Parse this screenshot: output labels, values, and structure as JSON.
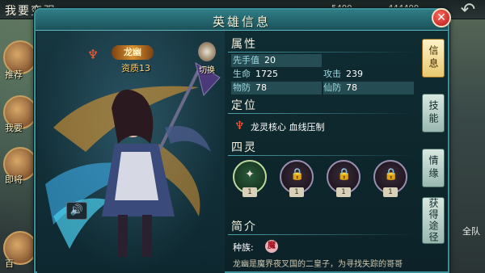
{
  "background": {
    "title": "我要变强",
    "resource_1": "5400",
    "resource_2": "444400",
    "left_labels": [
      "推荐",
      "我要",
      "即将",
      "百"
    ],
    "right_label": "全队"
  },
  "dialog": {
    "title": "英雄信息",
    "close_label": "✕"
  },
  "hero": {
    "name": "龙幽",
    "aptitude": "资质13",
    "switch_label": "切换",
    "faction_icon": "flame-icon",
    "voice_icon": "speaker-icon"
  },
  "attributes": {
    "section_title": "属性",
    "first_strike_label": "先手值",
    "first_strike_value": "20",
    "rows": [
      {
        "label": "生命",
        "value": "1725"
      },
      {
        "label": "攻击",
        "value": "239"
      },
      {
        "label": "物防",
        "value": "78"
      },
      {
        "label": "仙防",
        "value": "78"
      }
    ]
  },
  "position": {
    "section_title": "定位",
    "text": "龙灵核心 血线压制"
  },
  "spirits": {
    "section_title": "四灵",
    "slots": [
      {
        "level": "1",
        "state": "active"
      },
      {
        "level": "1",
        "state": "locked"
      },
      {
        "level": "1",
        "state": "locked"
      },
      {
        "level": "1",
        "state": "locked"
      }
    ]
  },
  "intro": {
    "section_title": "简介",
    "race_label": "种族:",
    "race_value": "魔",
    "bio": "龙幽是魔界夜叉国的二皇子，为寻找失踪的哥哥"
  },
  "tabs": [
    {
      "label": "信息",
      "active": true
    },
    {
      "label": "技能",
      "active": false
    },
    {
      "label": "情缘",
      "active": false
    },
    {
      "label": "获得途径",
      "active": false
    }
  ]
}
